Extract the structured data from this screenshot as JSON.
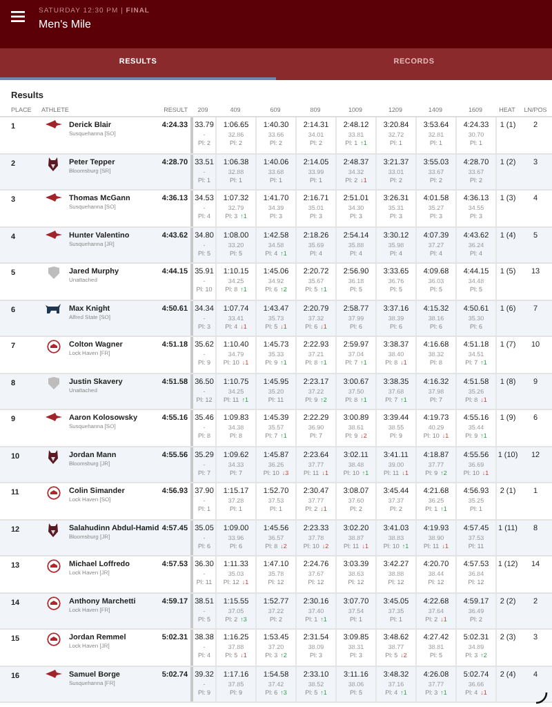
{
  "header": {
    "subtitle": "SATURDAY 12:30 PM | **FINAL**",
    "title": "Men's Mile"
  },
  "tabs": [
    {
      "label": "RESULTS",
      "selected": true
    },
    {
      "label": "RECORDS",
      "selected": false
    }
  ],
  "section_title": "Results",
  "columns": [
    "PLACE",
    "ATHLETE",
    "RESULT",
    "209",
    "409",
    "609",
    "809",
    "1009",
    "1209",
    "1409",
    "1609",
    "HEAT",
    "LN/POS"
  ],
  "rows": [
    {
      "place": "1",
      "kind": "hawk",
      "name": "Derick Blair",
      "team": "Susquehanna [SO]",
      "result": "4:24.33",
      "splits": [
        {
          "time": "33.79",
          "lap": "-",
          "pl": "Pl: 2"
        },
        {
          "time": "1:06.65",
          "lap": "32.86",
          "pl": "Pl: 2"
        },
        {
          "time": "1:40.30",
          "lap": "33.66",
          "pl": "Pl: 2"
        },
        {
          "time": "2:14.31",
          "lap": "34.01",
          "pl": "Pl: 2"
        },
        {
          "time": "2:48.12",
          "lap": "33.81",
          "pl": "Pl: 1",
          "change": {
            "rising": true,
            "text": "↑1"
          }
        },
        {
          "time": "3:20.84",
          "lap": "32.72",
          "pl": "Pl: 1"
        },
        {
          "time": "3:53.64",
          "lap": "32.81",
          "pl": "Pl: 1"
        },
        {
          "time": "4:24.33",
          "lap": "30.70",
          "pl": "Pl: 1"
        }
      ],
      "heat": "1 (1)",
      "lane": "2"
    },
    {
      "place": "2",
      "kind": "husky",
      "name": "Peter Tepper",
      "team": "Bloomsburg [SR]",
      "result": "4:28.70",
      "splits": [
        {
          "time": "33.51",
          "lap": "-",
          "pl": "Pl: 1"
        },
        {
          "time": "1:06.38",
          "lap": "32.88",
          "pl": "Pl: 1"
        },
        {
          "time": "1:40.06",
          "lap": "33.68",
          "pl": "Pl: 1"
        },
        {
          "time": "2:14.05",
          "lap": "33.99",
          "pl": "Pl: 1"
        },
        {
          "time": "2:48.37",
          "lap": "34.32",
          "pl": "Pl: 2",
          "change": {
            "rising": false,
            "text": "↓1"
          }
        },
        {
          "time": "3:21.37",
          "lap": "33.01",
          "pl": "Pl: 2"
        },
        {
          "time": "3:55.03",
          "lap": "33.67",
          "pl": "Pl: 2"
        },
        {
          "time": "4:28.70",
          "lap": "33.67",
          "pl": "Pl: 2"
        }
      ],
      "heat": "1 (2)",
      "lane": "3"
    },
    {
      "place": "3",
      "kind": "hawk",
      "name": "Thomas McGann",
      "team": "Susquehanna [SO]",
      "result": "4:36.13",
      "splits": [
        {
          "time": "34.53",
          "lap": "-",
          "pl": "Pl: 4"
        },
        {
          "time": "1:07.32",
          "lap": "32.79",
          "pl": "Pl: 3",
          "change": {
            "rising": true,
            "text": "↑1"
          }
        },
        {
          "time": "1:41.70",
          "lap": "34.39",
          "pl": "Pl: 3"
        },
        {
          "time": "2:16.71",
          "lap": "35.01",
          "pl": "Pl: 3"
        },
        {
          "time": "2:51.01",
          "lap": "34.30",
          "pl": "Pl: 3"
        },
        {
          "time": "3:26.31",
          "lap": "35.31",
          "pl": "Pl: 3"
        },
        {
          "time": "4:01.58",
          "lap": "35.27",
          "pl": "Pl: 3"
        },
        {
          "time": "4:36.13",
          "lap": "34.55",
          "pl": "Pl: 3"
        }
      ],
      "heat": "1 (3)",
      "lane": "4"
    },
    {
      "place": "4",
      "kind": "hawk",
      "name": "Hunter Valentino",
      "team": "Susquehanna [JR]",
      "result": "4:43.62",
      "splits": [
        {
          "time": "34.80",
          "lap": "-",
          "pl": "Pl: 5"
        },
        {
          "time": "1:08.00",
          "lap": "33.20",
          "pl": "Pl: 5"
        },
        {
          "time": "1:42.58",
          "lap": "34.58",
          "pl": "Pl: 4",
          "change": {
            "rising": true,
            "text": "↑1"
          }
        },
        {
          "time": "2:18.26",
          "lap": "35.69",
          "pl": "Pl: 4"
        },
        {
          "time": "2:54.14",
          "lap": "35.88",
          "pl": "Pl: 4"
        },
        {
          "time": "3:30.12",
          "lap": "35.98",
          "pl": "Pl: 4"
        },
        {
          "time": "4:07.39",
          "lap": "37.27",
          "pl": "Pl: 4"
        },
        {
          "time": "4:43.62",
          "lap": "36.24",
          "pl": "Pl: 4"
        }
      ],
      "heat": "1 (4)",
      "lane": "5"
    },
    {
      "place": "5",
      "kind": "shield",
      "name": "Jared Murphy",
      "team": "Unattached",
      "result": "4:44.15",
      "splits": [
        {
          "time": "35.91",
          "lap": "-",
          "pl": "Pl: 10"
        },
        {
          "time": "1:10.15",
          "lap": "34.25",
          "pl": "Pl: 8",
          "change": {
            "rising": true,
            "text": "↑1"
          }
        },
        {
          "time": "1:45.06",
          "lap": "34.92",
          "pl": "Pl: 6",
          "change": {
            "rising": true,
            "text": "↑2"
          }
        },
        {
          "time": "2:20.72",
          "lap": "35.67",
          "pl": "Pl: 5",
          "change": {
            "rising": true,
            "text": "↑1"
          }
        },
        {
          "time": "2:56.90",
          "lap": "36.18",
          "pl": "Pl: 5"
        },
        {
          "time": "3:33.65",
          "lap": "36.76",
          "pl": "Pl: 5"
        },
        {
          "time": "4:09.68",
          "lap": "36.03",
          "pl": "Pl: 5"
        },
        {
          "time": "4:44.15",
          "lap": "34.48",
          "pl": "Pl: 5"
        }
      ],
      "heat": "1 (5)",
      "lane": "13"
    },
    {
      "place": "6",
      "kind": "bull",
      "name": "Max Knight",
      "team": "Alfred State [SO]",
      "result": "4:50.61",
      "splits": [
        {
          "time": "34.34",
          "lap": "-",
          "pl": "Pl: 3"
        },
        {
          "time": "1:07.74",
          "lap": "33.41",
          "pl": "Pl: 4",
          "change": {
            "rising": false,
            "text": "↓1"
          }
        },
        {
          "time": "1:43.47",
          "lap": "35.73",
          "pl": "Pl: 5",
          "change": {
            "rising": false,
            "text": "↓1"
          }
        },
        {
          "time": "2:20.79",
          "lap": "37.32",
          "pl": "Pl: 6",
          "change": {
            "rising": false,
            "text": "↓1"
          }
        },
        {
          "time": "2:58.77",
          "lap": "37.99",
          "pl": "Pl: 6"
        },
        {
          "time": "3:37.16",
          "lap": "38.39",
          "pl": "Pl: 6"
        },
        {
          "time": "4:15.32",
          "lap": "38.16",
          "pl": "Pl: 6"
        },
        {
          "time": "4:50.61",
          "lap": "35.30",
          "pl": "Pl: 6"
        }
      ],
      "heat": "1 (6)",
      "lane": "7"
    },
    {
      "place": "7",
      "kind": "circle",
      "name": "Colton Wagner",
      "team": "Lock Haven [FR]",
      "result": "4:51.18",
      "splits": [
        {
          "time": "35.62",
          "lap": "-",
          "pl": "Pl: 9"
        },
        {
          "time": "1:10.40",
          "lap": "34.79",
          "pl": "Pl: 10",
          "change": {
            "rising": false,
            "text": "↓1"
          }
        },
        {
          "time": "1:45.73",
          "lap": "35.33",
          "pl": "Pl: 9",
          "change": {
            "rising": true,
            "text": "↑1"
          }
        },
        {
          "time": "2:22.93",
          "lap": "37.21",
          "pl": "Pl: 8",
          "change": {
            "rising": true,
            "text": "↑1"
          }
        },
        {
          "time": "2:59.97",
          "lap": "37.04",
          "pl": "Pl: 7",
          "change": {
            "rising": true,
            "text": "↑1"
          }
        },
        {
          "time": "3:38.37",
          "lap": "38.40",
          "pl": "Pl: 8",
          "change": {
            "rising": false,
            "text": "↓1"
          }
        },
        {
          "time": "4:16.68",
          "lap": "38.32",
          "pl": "Pl: 8"
        },
        {
          "time": "4:51.18",
          "lap": "34.51",
          "pl": "Pl: 7",
          "change": {
            "rising": true,
            "text": "↑1"
          }
        }
      ],
      "heat": "1 (7)",
      "lane": "10"
    },
    {
      "place": "8",
      "kind": "shield",
      "name": "Justin Skavery",
      "team": "Unattached",
      "result": "4:51.58",
      "splits": [
        {
          "time": "36.50",
          "lap": "-",
          "pl": "Pl: 12"
        },
        {
          "time": "1:10.75",
          "lap": "34.25",
          "pl": "Pl: 11",
          "change": {
            "rising": true,
            "text": "↑1"
          }
        },
        {
          "time": "1:45.95",
          "lap": "35.20",
          "pl": "Pl: 11"
        },
        {
          "time": "2:23.17",
          "lap": "37.22",
          "pl": "Pl: 9",
          "change": {
            "rising": true,
            "text": "↑2"
          }
        },
        {
          "time": "3:00.67",
          "lap": "37.50",
          "pl": "Pl: 8",
          "change": {
            "rising": true,
            "text": "↑1"
          }
        },
        {
          "time": "3:38.35",
          "lap": "37.68",
          "pl": "Pl: 7",
          "change": {
            "rising": true,
            "text": "↑1"
          }
        },
        {
          "time": "4:16.32",
          "lap": "37.98",
          "pl": "Pl: 7"
        },
        {
          "time": "4:51.58",
          "lap": "35.26",
          "pl": "Pl: 8",
          "change": {
            "rising": false,
            "text": "↓1"
          }
        }
      ],
      "heat": "1 (8)",
      "lane": "9"
    },
    {
      "place": "9",
      "kind": "hawk",
      "name": "Aaron Kolosowsky",
      "team": "Susquehanna [SO]",
      "result": "4:55.16",
      "splits": [
        {
          "time": "35.46",
          "lap": "-",
          "pl": "Pl: 8"
        },
        {
          "time": "1:09.83",
          "lap": "34.38",
          "pl": "Pl: 8"
        },
        {
          "time": "1:45.39",
          "lap": "35.57",
          "pl": "Pl: 7",
          "change": {
            "rising": true,
            "text": "↑1"
          }
        },
        {
          "time": "2:22.29",
          "lap": "36.90",
          "pl": "Pl: 7"
        },
        {
          "time": "3:00.89",
          "lap": "38.61",
          "pl": "Pl: 9",
          "change": {
            "rising": false,
            "text": "↓2"
          }
        },
        {
          "time": "3:39.44",
          "lap": "38.55",
          "pl": "Pl: 9"
        },
        {
          "time": "4:19.73",
          "lap": "40.29",
          "pl": "Pl: 10",
          "change": {
            "rising": false,
            "text": "↓1"
          }
        },
        {
          "time": "4:55.16",
          "lap": "35.44",
          "pl": "Pl: 9",
          "change": {
            "rising": true,
            "text": "↑1"
          }
        }
      ],
      "heat": "1 (9)",
      "lane": "6"
    },
    {
      "place": "10",
      "kind": "husky",
      "name": "Jordan Mann",
      "team": "Bloomsburg [JR]",
      "result": "4:55.56",
      "splits": [
        {
          "time": "35.29",
          "lap": "-",
          "pl": "Pl: 7"
        },
        {
          "time": "1:09.62",
          "lap": "34.33",
          "pl": "Pl: 7"
        },
        {
          "time": "1:45.87",
          "lap": "36.26",
          "pl": "Pl: 10",
          "change": {
            "rising": false,
            "text": "↓3"
          }
        },
        {
          "time": "2:23.64",
          "lap": "37.77",
          "pl": "Pl: 11",
          "change": {
            "rising": false,
            "text": "↓1"
          }
        },
        {
          "time": "3:02.11",
          "lap": "38.48",
          "pl": "Pl: 10",
          "change": {
            "rising": true,
            "text": "↑1"
          }
        },
        {
          "time": "3:41.11",
          "lap": "39.00",
          "pl": "Pl: 11",
          "change": {
            "rising": false,
            "text": "↓1"
          }
        },
        {
          "time": "4:18.87",
          "lap": "37.77",
          "pl": "Pl: 9",
          "change": {
            "rising": true,
            "text": "↑2"
          }
        },
        {
          "time": "4:55.56",
          "lap": "36.69",
          "pl": "Pl: 10",
          "change": {
            "rising": false,
            "text": "↓1"
          }
        }
      ],
      "heat": "1 (10)",
      "lane": "12"
    },
    {
      "place": "11",
      "kind": "circle",
      "name": "Colin Simander",
      "team": "Lock Haven [SO]",
      "result": "4:56.93",
      "splits": [
        {
          "time": "37.90",
          "lap": "-",
          "pl": "Pl: 1"
        },
        {
          "time": "1:15.17",
          "lap": "37.28",
          "pl": "Pl: 1"
        },
        {
          "time": "1:52.70",
          "lap": "37.53",
          "pl": "Pl: 1"
        },
        {
          "time": "2:30.47",
          "lap": "37.77",
          "pl": "Pl: 2",
          "change": {
            "rising": false,
            "text": "↓1"
          }
        },
        {
          "time": "3:08.07",
          "lap": "37.60",
          "pl": "Pl: 2"
        },
        {
          "time": "3:45.44",
          "lap": "37.37",
          "pl": "Pl: 2"
        },
        {
          "time": "4:21.68",
          "lap": "36.25",
          "pl": "Pl: 1",
          "change": {
            "rising": true,
            "text": "↑1"
          }
        },
        {
          "time": "4:56.93",
          "lap": "35.25",
          "pl": "Pl: 1"
        }
      ],
      "heat": "2 (1)",
      "lane": "1"
    },
    {
      "place": "12",
      "kind": "husky",
      "name": "Salahudinn Abdul-Hamid",
      "team": "Bloomsburg [JR]",
      "result": "4:57.45",
      "splits": [
        {
          "time": "35.05",
          "lap": "-",
          "pl": "Pl: 6"
        },
        {
          "time": "1:09.00",
          "lap": "33.96",
          "pl": "Pl: 6"
        },
        {
          "time": "1:45.56",
          "lap": "36.57",
          "pl": "Pl: 8",
          "change": {
            "rising": false,
            "text": "↓2"
          }
        },
        {
          "time": "2:23.33",
          "lap": "37.78",
          "pl": "Pl: 10",
          "change": {
            "rising": false,
            "text": "↓2"
          }
        },
        {
          "time": "3:02.20",
          "lap": "38.87",
          "pl": "Pl: 11",
          "change": {
            "rising": false,
            "text": "↓1"
          }
        },
        {
          "time": "3:41.03",
          "lap": "38.83",
          "pl": "Pl: 10",
          "change": {
            "rising": true,
            "text": "↑1"
          }
        },
        {
          "time": "4:19.93",
          "lap": "38.90",
          "pl": "Pl: 11",
          "change": {
            "rising": false,
            "text": "↓1"
          }
        },
        {
          "time": "4:57.45",
          "lap": "37.53",
          "pl": "Pl: 11"
        }
      ],
      "heat": "1 (11)",
      "lane": "8"
    },
    {
      "place": "13",
      "kind": "circle",
      "name": "Michael Loffredo",
      "team": "Lock Haven [JR]",
      "result": "4:57.53",
      "splits": [
        {
          "time": "36.30",
          "lap": "-",
          "pl": "Pl: 11"
        },
        {
          "time": "1:11.33",
          "lap": "35.03",
          "pl": "Pl: 12",
          "change": {
            "rising": false,
            "text": "↓1"
          }
        },
        {
          "time": "1:47.10",
          "lap": "35.78",
          "pl": "Pl: 12"
        },
        {
          "time": "2:24.76",
          "lap": "37.67",
          "pl": "Pl: 12"
        },
        {
          "time": "3:03.39",
          "lap": "38.63",
          "pl": "Pl: 12"
        },
        {
          "time": "3:42.27",
          "lap": "38.88",
          "pl": "Pl: 12"
        },
        {
          "time": "4:20.70",
          "lap": "38.44",
          "pl": "Pl: 12"
        },
        {
          "time": "4:57.53",
          "lap": "36.84",
          "pl": "Pl: 12"
        }
      ],
      "heat": "1 (12)",
      "lane": "14"
    },
    {
      "place": "14",
      "kind": "circle",
      "name": "Anthony Marchetti",
      "team": "Lock Haven [FR]",
      "result": "4:59.17",
      "splits": [
        {
          "time": "38.51",
          "lap": "-",
          "pl": "Pl: 5"
        },
        {
          "time": "1:15.55",
          "lap": "37.05",
          "pl": "Pl: 2",
          "change": {
            "rising": true,
            "text": "↑3"
          }
        },
        {
          "time": "1:52.77",
          "lap": "37.22",
          "pl": "Pl: 2"
        },
        {
          "time": "2:30.16",
          "lap": "37.40",
          "pl": "Pl: 1",
          "change": {
            "rising": true,
            "text": "↑1"
          }
        },
        {
          "time": "3:07.70",
          "lap": "37.54",
          "pl": "Pl: 1"
        },
        {
          "time": "3:45.05",
          "lap": "37.35",
          "pl": "Pl: 1"
        },
        {
          "time": "4:22.68",
          "lap": "37.64",
          "pl": "Pl: 2",
          "change": {
            "rising": false,
            "text": "↓1"
          }
        },
        {
          "time": "4:59.17",
          "lap": "36.49",
          "pl": "Pl: 2"
        }
      ],
      "heat": "2 (2)",
      "lane": "2"
    },
    {
      "place": "15",
      "kind": "circle",
      "name": "Jordan Remmel",
      "team": "Lock Haven [JR]",
      "result": "5:02.31",
      "splits": [
        {
          "time": "38.38",
          "lap": "-",
          "pl": "Pl: 4"
        },
        {
          "time": "1:16.25",
          "lap": "37.88",
          "pl": "Pl: 5",
          "change": {
            "rising": false,
            "text": "↓1"
          }
        },
        {
          "time": "1:53.45",
          "lap": "37.20",
          "pl": "Pl: 3",
          "change": {
            "rising": true,
            "text": "↑2"
          }
        },
        {
          "time": "2:31.54",
          "lap": "38.09",
          "pl": "Pl: 3"
        },
        {
          "time": "3:09.85",
          "lap": "38.31",
          "pl": "Pl: 3"
        },
        {
          "time": "3:48.62",
          "lap": "38.77",
          "pl": "Pl: 5",
          "change": {
            "rising": false,
            "text": "↓2"
          }
        },
        {
          "time": "4:27.42",
          "lap": "38.81",
          "pl": "Pl: 5"
        },
        {
          "time": "5:02.31",
          "lap": "34.89",
          "pl": "Pl: 3",
          "change": {
            "rising": true,
            "text": "↑2"
          }
        }
      ],
      "heat": "2 (3)",
      "lane": "3"
    },
    {
      "place": "16",
      "kind": "hawk",
      "name": "Samuel Borge",
      "team": "Susquehanna [FR]",
      "result": "5:02.74",
      "splits": [
        {
          "time": "39.32",
          "lap": "-",
          "pl": "Pl: 9"
        },
        {
          "time": "1:17.16",
          "lap": "37.85",
          "pl": "Pl: 9"
        },
        {
          "time": "1:54.58",
          "lap": "37.42",
          "pl": "Pl: 6",
          "change": {
            "rising": true,
            "text": "↑3"
          }
        },
        {
          "time": "2:33.10",
          "lap": "38.52",
          "pl": "Pl: 5",
          "change": {
            "rising": true,
            "text": "↑1"
          }
        },
        {
          "time": "3:11.16",
          "lap": "38.06",
          "pl": "Pl: 5"
        },
        {
          "time": "3:48.32",
          "lap": "37.16",
          "pl": "Pl: 4",
          "change": {
            "rising": true,
            "text": "↑1"
          }
        },
        {
          "time": "4:26.08",
          "lap": "37.77",
          "pl": "Pl: 3",
          "change": {
            "rising": true,
            "text": "↑1"
          }
        },
        {
          "time": "5:02.74",
          "lap": "36.66",
          "pl": "Pl: 4",
          "change": {
            "rising": false,
            "text": "↓1"
          }
        }
      ],
      "heat": "2 (4)",
      "lane": "4"
    }
  ]
}
